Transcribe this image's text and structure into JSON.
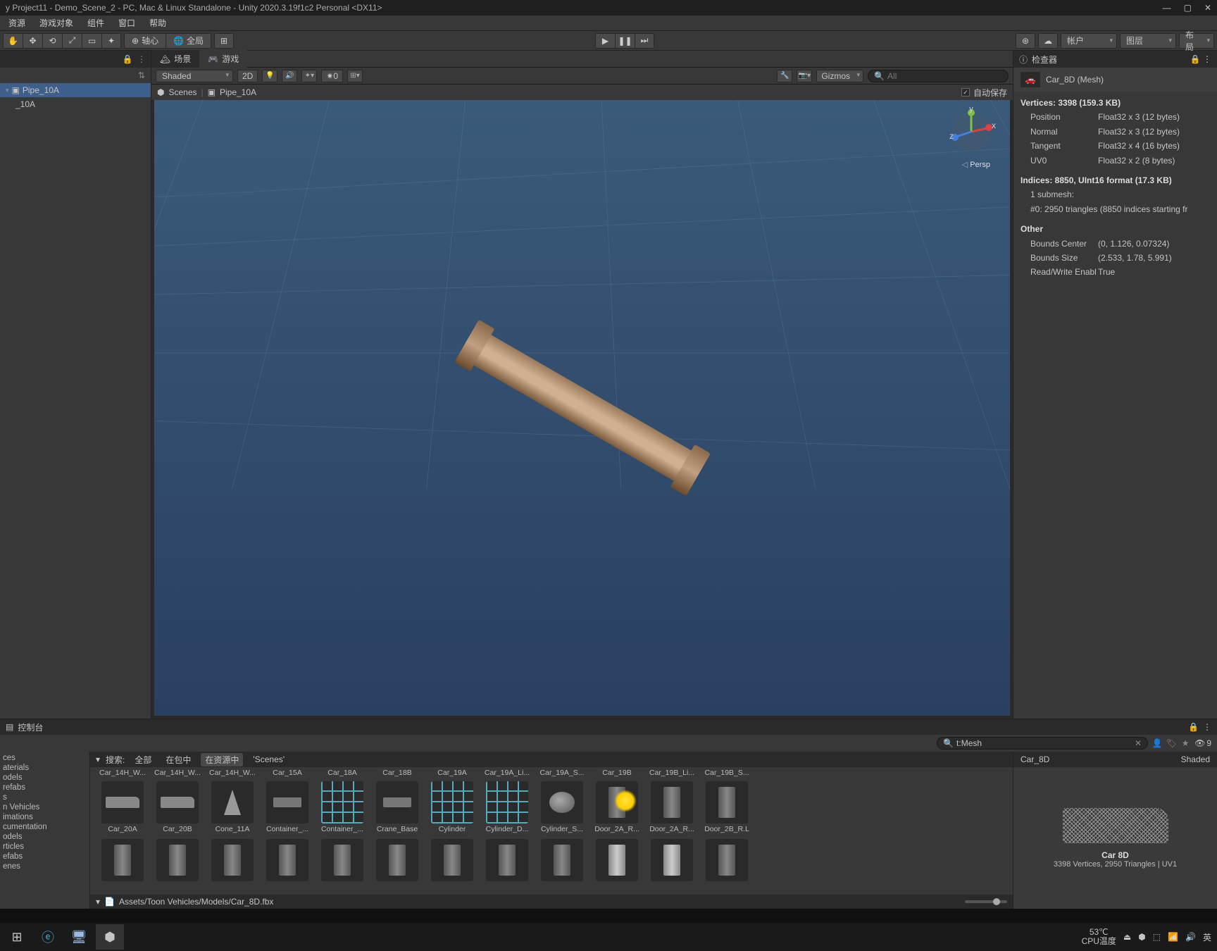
{
  "window": {
    "title": "y Project11 - Demo_Scene_2 - PC, Mac & Linux Standalone - Unity 2020.3.19f1c2 Personal <DX11>"
  },
  "menu": {
    "items": [
      "资源",
      "游戏对象",
      "组件",
      "窗口",
      "帮助"
    ]
  },
  "toolbar": {
    "center_label": "轴心",
    "global_label": "全局",
    "account": "帐户",
    "layers": "图层",
    "layout": "布局"
  },
  "hierarchy": {
    "root": "Pipe_10A",
    "child": "_10A"
  },
  "sceneTabs": {
    "scene": "场景",
    "game": "游戏"
  },
  "sceneToolbar": {
    "shaded": "Shaded",
    "mode2d": "2D",
    "skybox": "✷0",
    "gizmos": "Gizmos",
    "searchPlaceholder": "All"
  },
  "breadcrumb": {
    "scenes": "Scenes",
    "current": "Pipe_10A",
    "autosave": "自动保存"
  },
  "persp": "Persp",
  "inspector": {
    "tab": "检查器",
    "title": "Car_8D (Mesh)",
    "vertices_header": "Vertices: 3398 (159.3 KB)",
    "attrs": [
      {
        "k": "Position",
        "v": "Float32 x 3 (12 bytes)"
      },
      {
        "k": "Normal",
        "v": "Float32 x 3 (12 bytes)"
      },
      {
        "k": "Tangent",
        "v": "Float32 x 4 (16 bytes)"
      },
      {
        "k": "UV0",
        "v": "Float32 x 2 (8 bytes)"
      }
    ],
    "indices_header": "Indices: 8850, UInt16 format (17.3 KB)",
    "submesh1": "1 submesh:",
    "submesh2": "#0: 2950 triangles (8850 indices starting fr",
    "other": "Other",
    "other_rows": [
      {
        "k": "Bounds Center",
        "v": "(0, 1.126, 0.07324)"
      },
      {
        "k": "Bounds Size",
        "v": "(2.533, 1.78, 5.991)"
      },
      {
        "k": "Read/Write Enabl",
        "v": "True"
      }
    ]
  },
  "console": {
    "tab": "控制台"
  },
  "project": {
    "searchLabel": "搜索:",
    "searchValue": "t:Mesh",
    "filters": {
      "all": "全部",
      "inPack": "在包中",
      "inAssets": "在资源中",
      "scenes": "'Scenes'"
    },
    "hiddenCount": "9",
    "tree": [
      "ces",
      "aterials",
      "odels",
      "refabs",
      "s",
      "n Vehicles",
      "imations",
      "cumentation",
      "odels",
      "rticles",
      "efabs",
      "enes"
    ],
    "row1_labels": [
      "Car_14H_W...",
      "Car_14H_W...",
      "Car_14H_W...",
      "Car_15A",
      "Car_18A",
      "Car_18B",
      "Car_19A",
      "Car_19A_Li...",
      "Car_19A_S...",
      "Car_19B",
      "Car_19B_Li...",
      "Car_19B_S..."
    ],
    "row2_labels": [
      "Car_20A",
      "Car_20B",
      "Cone_11A",
      "Container_...",
      "Container_...",
      "Crane_Base",
      "Cylinder",
      "Cylinder_D...",
      "Cylinder_S...",
      "Door_2A_R...",
      "Door_2A_R...",
      "Door_2B_R.L"
    ],
    "path": "Assets/Toon Vehicles/Models/Car_8D.fbx"
  },
  "preview": {
    "name": "Car_8D",
    "shaded": "Shaded",
    "title": "Car 8D",
    "stats": "3398 Vertices, 2950 Triangles | UV1"
  },
  "system": {
    "temp": "53℃",
    "tempLabel": "CPU温度",
    "ime": "英"
  }
}
